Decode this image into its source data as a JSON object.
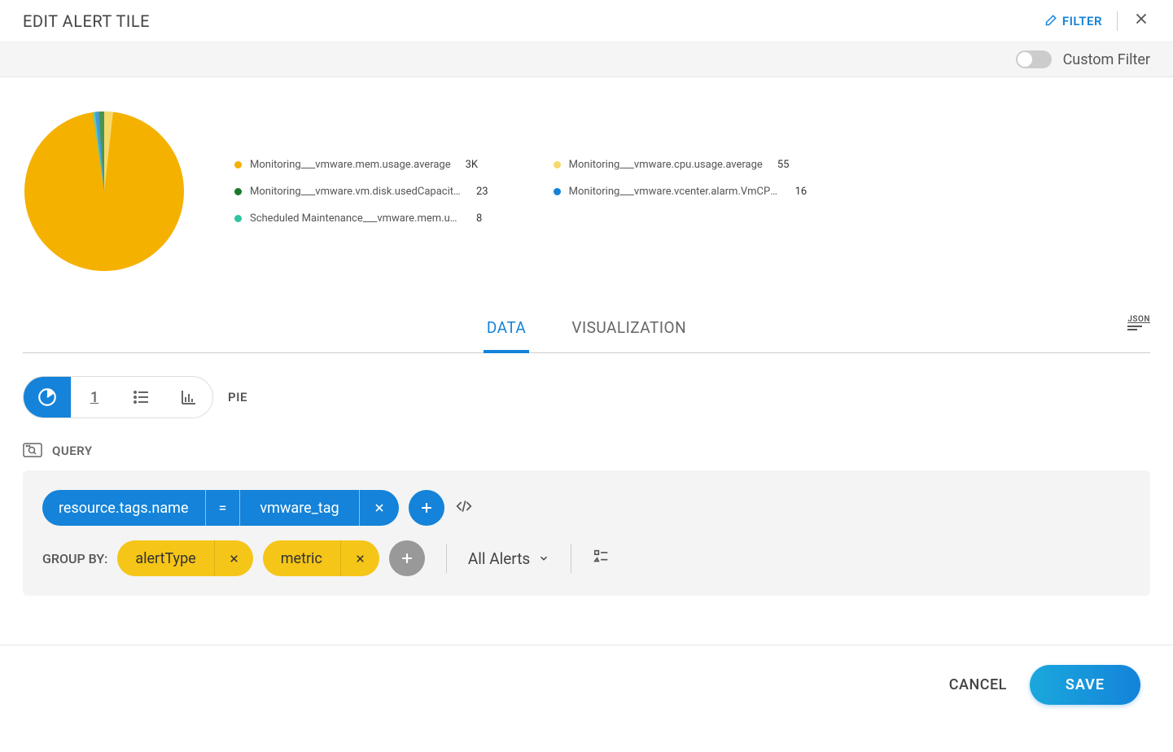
{
  "header": {
    "title": "EDIT ALERT TILE",
    "filter_label": "FILTER"
  },
  "subheader": {
    "custom_filter_label": "Custom Filter",
    "custom_filter_on": false
  },
  "chart_data": {
    "type": "pie",
    "title": "",
    "series": [
      {
        "name": "Monitoring___vmware.mem.usage.average",
        "value": 3000,
        "display": "3K",
        "color": "#f5b100"
      },
      {
        "name": "Monitoring___vmware.cpu.usage.average",
        "value": 55,
        "display": "55",
        "color": "#f5d96b"
      },
      {
        "name": "Monitoring___vmware.vm.disk.usedCapacity.per...",
        "value": 23,
        "display": "23",
        "color": "#1a7a2a"
      },
      {
        "name": "Monitoring___vmware.vcenter.alarm.VmCPUUs...",
        "value": 16,
        "display": "16",
        "color": "#1483d9"
      },
      {
        "name": "Scheduled Maintenance___vmware.mem.usage....",
        "value": 8,
        "display": "8",
        "color": "#2ec4a0"
      }
    ]
  },
  "tabs": {
    "data": "DATA",
    "visualization": "VISUALIZATION",
    "active": "data",
    "json_label": "JSON"
  },
  "viz": {
    "selected_label": "PIE",
    "number_label": "1"
  },
  "query": {
    "label": "QUERY",
    "filter": {
      "field": "resource.tags.name",
      "op": "=",
      "value": "vmware_tag"
    },
    "groupby_label": "GROUP BY:",
    "groups": [
      {
        "name": "alertType"
      },
      {
        "name": "metric"
      }
    ],
    "dropdown_label": "All Alerts"
  },
  "footer": {
    "cancel": "CANCEL",
    "save": "SAVE"
  }
}
